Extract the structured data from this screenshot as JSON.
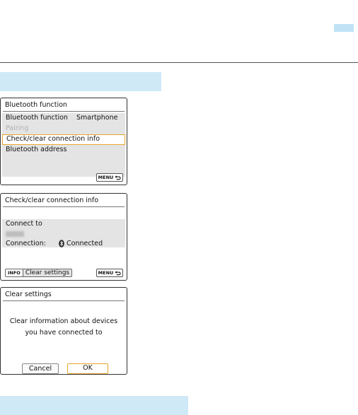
{
  "screen1": {
    "title": "Bluetooth function",
    "items": [
      {
        "label": "Bluetooth function",
        "value": "Smartphone"
      },
      {
        "label": "Pairing",
        "value": ""
      },
      {
        "label": "Check/clear connection info",
        "value": ""
      },
      {
        "label": "Bluetooth address",
        "value": ""
      }
    ],
    "menu_button": "MENU"
  },
  "screen2": {
    "title": "Check/clear connection info",
    "connect_to_label": "Connect to",
    "connection_label": "Connection:",
    "connection_value": "Connected",
    "info_tag": "INFO",
    "info_label": "Clear settings",
    "menu_button": "MENU"
  },
  "screen3": {
    "title": "Clear settings",
    "message_line1": "Clear information about devices",
    "message_line2": "you have connected to",
    "cancel_label": "Cancel",
    "ok_label": "OK"
  },
  "colors": {
    "accent_band": "#cfe9f7",
    "selection_border": "#e8a52e"
  }
}
